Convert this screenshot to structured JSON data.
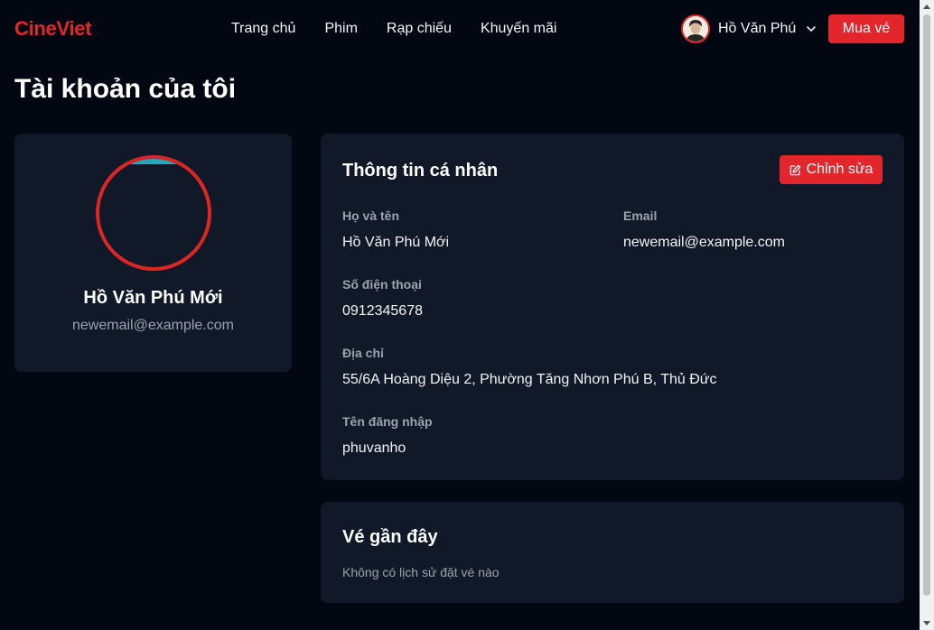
{
  "header": {
    "logo": "CineViet",
    "nav": [
      "Trang chủ",
      "Phim",
      "Rạp chiếu",
      "Khuyến mãi"
    ],
    "user_name": "Hồ Văn Phú",
    "buy_label": "Mua vé"
  },
  "page": {
    "title": "Tài khoản của tôi"
  },
  "profile": {
    "name": "Hồ Văn Phú Mới",
    "email": "newemail@example.com"
  },
  "personal_info": {
    "title": "Thông tin cá nhân",
    "edit_label": "Chỉnh sửa",
    "fields": {
      "full_name": {
        "label": "Họ và tên",
        "value": "Hồ Văn Phú Mới"
      },
      "email": {
        "label": "Email",
        "value": "newemail@example.com"
      },
      "phone": {
        "label": "Số điện thoại",
        "value": "0912345678"
      },
      "address": {
        "label": "Địa chỉ",
        "value": "55/6A Hoàng Diệu 2, Phường Tăng Nhơn Phú B, Thủ Đức"
      },
      "username": {
        "label": "Tên đăng nhập",
        "value": "phuvanho"
      }
    }
  },
  "recent_tickets": {
    "title": "Vé gần đây",
    "empty": "Không có lịch sử đặt vé nào"
  },
  "colors": {
    "accent": "#e3262c",
    "background": "#030712",
    "card": "#111827",
    "muted_text": "#9ca3af"
  }
}
